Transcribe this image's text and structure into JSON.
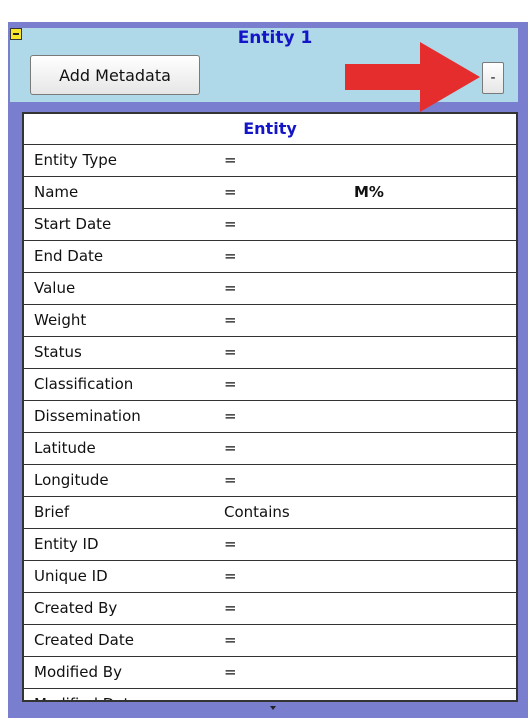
{
  "header": {
    "title": "Entity 1",
    "add_metadata_label": "Add Metadata",
    "collapse_button_label": "-"
  },
  "colors": {
    "panel_border": "#7a7ecf",
    "header_background": "#afd8e8",
    "title_text": "#1515c8",
    "arrow": "#e52d2d",
    "toggle": "#f6e52a"
  },
  "table": {
    "heading": "Entity",
    "rows": [
      {
        "label": "Entity Type",
        "op": "=",
        "value": ""
      },
      {
        "label": "Name",
        "op": "=",
        "value": "M%"
      },
      {
        "label": "Start Date",
        "op": "=",
        "value": ""
      },
      {
        "label": "End Date",
        "op": "=",
        "value": ""
      },
      {
        "label": "Value",
        "op": "=",
        "value": ""
      },
      {
        "label": "Weight",
        "op": "=",
        "value": ""
      },
      {
        "label": "Status",
        "op": "=",
        "value": ""
      },
      {
        "label": "Classification",
        "op": "=",
        "value": ""
      },
      {
        "label": "Dissemination",
        "op": "=",
        "value": ""
      },
      {
        "label": "Latitude",
        "op": "=",
        "value": ""
      },
      {
        "label": "Longitude",
        "op": "=",
        "value": ""
      },
      {
        "label": "Brief",
        "op": "Contains",
        "value": ""
      },
      {
        "label": "Entity ID",
        "op": "=",
        "value": ""
      },
      {
        "label": "Unique ID",
        "op": "=",
        "value": ""
      },
      {
        "label": "Created By",
        "op": "=",
        "value": ""
      },
      {
        "label": "Created Date",
        "op": "=",
        "value": ""
      },
      {
        "label": "Modified By",
        "op": "=",
        "value": ""
      },
      {
        "label": "Modified Date",
        "op": "=",
        "value": ""
      }
    ]
  }
}
